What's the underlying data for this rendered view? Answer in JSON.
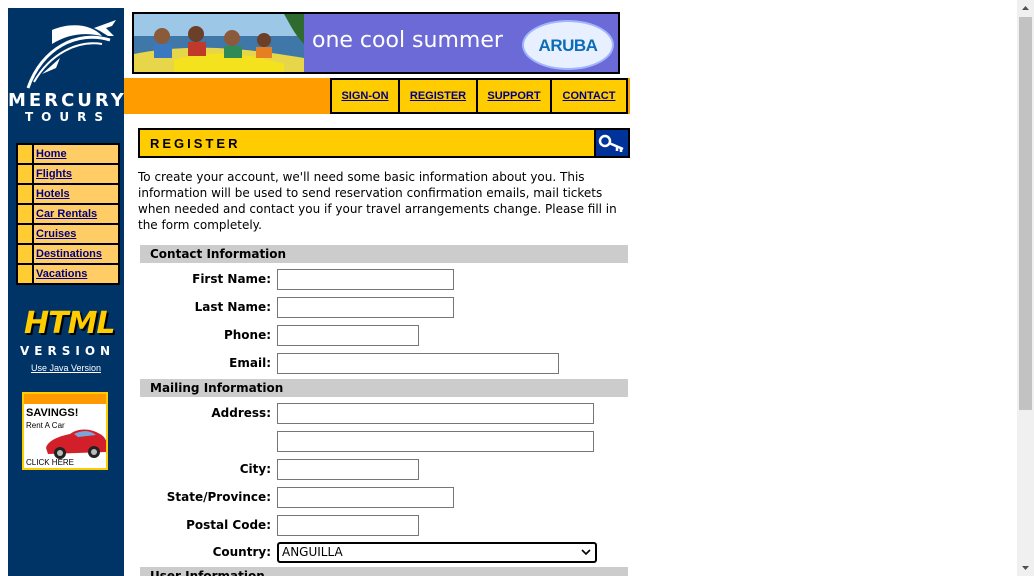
{
  "brand": {
    "line1": "MERCURY",
    "line2": "TOURS"
  },
  "left_nav": [
    {
      "label": "Home"
    },
    {
      "label": "Flights"
    },
    {
      "label": "Hotels"
    },
    {
      "label": "Car Rentals"
    },
    {
      "label": "Cruises"
    },
    {
      "label": "Destinations"
    },
    {
      "label": "Vacations"
    }
  ],
  "html_badge": {
    "word": "HTML",
    "version": "VERSION",
    "java_link": "Use Java Version"
  },
  "ad": {
    "headline": "SAVINGS!",
    "sub": "Rent A Car",
    "cta": "CLICK HERE"
  },
  "banner": {
    "text": "one cool summer",
    "logo": "ARUBA"
  },
  "top_menu": [
    {
      "label": "SIGN-ON"
    },
    {
      "label": "REGISTER"
    },
    {
      "label": "SUPPORT"
    },
    {
      "label": "CONTACT"
    }
  ],
  "page": {
    "title": "REGISTER",
    "intro": "To create your account, we'll need some basic information about you. This information will be used to send reservation confirmation emails, mail tickets when needed and contact you if your travel arrangements change. Please fill in the form completely."
  },
  "sections": {
    "contact": "Contact Information",
    "mailing": "Mailing Information",
    "user": "User Information"
  },
  "fields": {
    "first_name": {
      "label": "First Name:",
      "value": ""
    },
    "last_name": {
      "label": "Last Name:",
      "value": ""
    },
    "phone": {
      "label": "Phone:",
      "value": ""
    },
    "email": {
      "label": "Email:",
      "value": ""
    },
    "address": {
      "label": "Address:",
      "value": "",
      "value2": ""
    },
    "city": {
      "label": "City:",
      "value": ""
    },
    "state": {
      "label": "State/Province:",
      "value": ""
    },
    "postal": {
      "label": "Postal Code:",
      "value": ""
    },
    "country": {
      "label": "Country:",
      "value": "ANGUILLA"
    }
  },
  "colors": {
    "sidebar": "#003366",
    "nav_item": "#ffcc66",
    "accent_orange": "#ff9c00",
    "accent_yellow": "#ffcc00",
    "section_gray": "#cccccc"
  },
  "icons": [
    "jet-swoosh-logo-icon",
    "key-icon",
    "car-icon",
    "chevron-down-icon",
    "scroll-up-icon",
    "scroll-down-icon"
  ]
}
